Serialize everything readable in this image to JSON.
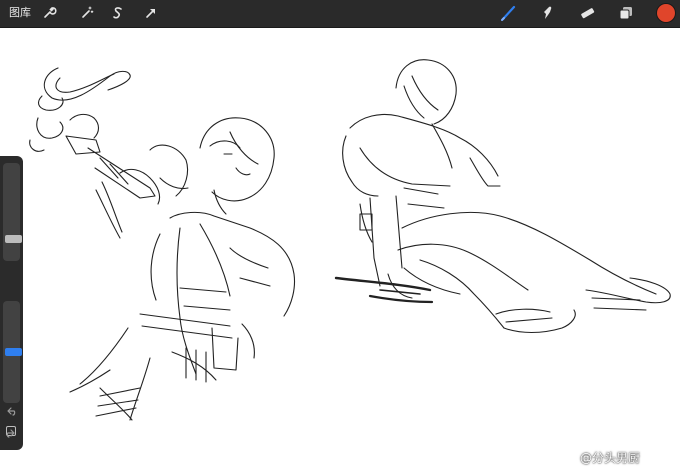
{
  "topbar": {
    "gallery_label": "图库",
    "left_tools": [
      {
        "name": "wrench-icon",
        "action": "actions"
      },
      {
        "name": "magic-wand-icon",
        "action": "adjustments"
      },
      {
        "name": "s-selection-icon",
        "action": "selection"
      },
      {
        "name": "arrow-cursor-icon",
        "action": "transform"
      }
    ],
    "right_tools": [
      {
        "name": "brush-icon",
        "action": "paint",
        "active": true
      },
      {
        "name": "smudge-icon",
        "action": "smudge"
      },
      {
        "name": "eraser-icon",
        "action": "erase"
      },
      {
        "name": "layers-icon",
        "action": "layers"
      }
    ],
    "current_color": "#e0452b",
    "accent_color": "#2f7ff0"
  },
  "sidebar": {
    "brush_size_level": 0.2,
    "opacity_level": 0.5,
    "modify_icon": "square-icon",
    "undo_icon": "undo-icon",
    "redo_icon": "redo-icon"
  },
  "watermark": {
    "text": "@分头男厨"
  }
}
